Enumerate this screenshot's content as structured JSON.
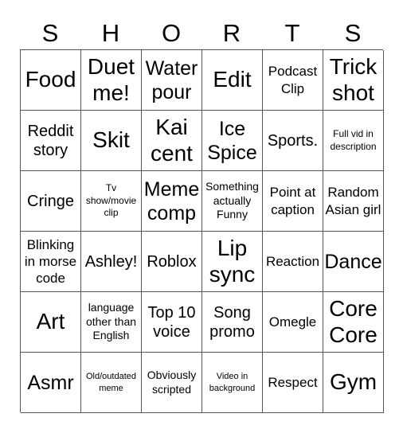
{
  "title_letters": [
    "S",
    "H",
    "O",
    "R",
    "T",
    "S"
  ],
  "cells": [
    [
      {
        "text": "Food",
        "size": "xl"
      },
      {
        "text": "Duet me!",
        "size": "xl"
      },
      {
        "text": "Water pour",
        "size": "lg"
      },
      {
        "text": "Edit",
        "size": "xl"
      },
      {
        "text": "Podcast Clip",
        "size": "sm"
      },
      {
        "text": "Trick shot",
        "size": "xl"
      }
    ],
    [
      {
        "text": "Reddit story",
        "size": "md"
      },
      {
        "text": "Skit",
        "size": "xl"
      },
      {
        "text": "Kai cent",
        "size": "xl"
      },
      {
        "text": "Ice Spice",
        "size": "lg"
      },
      {
        "text": "Sports.",
        "size": "md"
      },
      {
        "text": "Full vid in description",
        "size": "xxs"
      }
    ],
    [
      {
        "text": "Cringe",
        "size": "md"
      },
      {
        "text": "Tv show/movie clip",
        "size": "xxs"
      },
      {
        "text": "Meme comp",
        "size": "lg"
      },
      {
        "text": "Something actually Funny",
        "size": "xs"
      },
      {
        "text": "Point at caption",
        "size": "sm"
      },
      {
        "text": "Random Asian girl",
        "size": "sm"
      }
    ],
    [
      {
        "text": "Blinking in morse code",
        "size": "sm"
      },
      {
        "text": "Ashley!",
        "size": "md"
      },
      {
        "text": "Roblox",
        "size": "md"
      },
      {
        "text": "Lip sync",
        "size": "xl"
      },
      {
        "text": "Reaction",
        "size": "sm"
      },
      {
        "text": "Dance",
        "size": "lg"
      }
    ],
    [
      {
        "text": "Art",
        "size": "xl"
      },
      {
        "text": "language other than English",
        "size": "xs"
      },
      {
        "text": "Top 10 voice",
        "size": "md"
      },
      {
        "text": "Song promo",
        "size": "md"
      },
      {
        "text": "Omegle",
        "size": "sm"
      },
      {
        "text": "Core Core",
        "size": "xl"
      }
    ],
    [
      {
        "text": "Asmr",
        "size": "lg"
      },
      {
        "text": "Old/outdated meme",
        "size": "tiny"
      },
      {
        "text": "Obviously scripted",
        "size": "xs"
      },
      {
        "text": "Video in background",
        "size": "tiny"
      },
      {
        "text": "Respect",
        "size": "sm"
      },
      {
        "text": "Gym",
        "size": "xl"
      }
    ]
  ]
}
